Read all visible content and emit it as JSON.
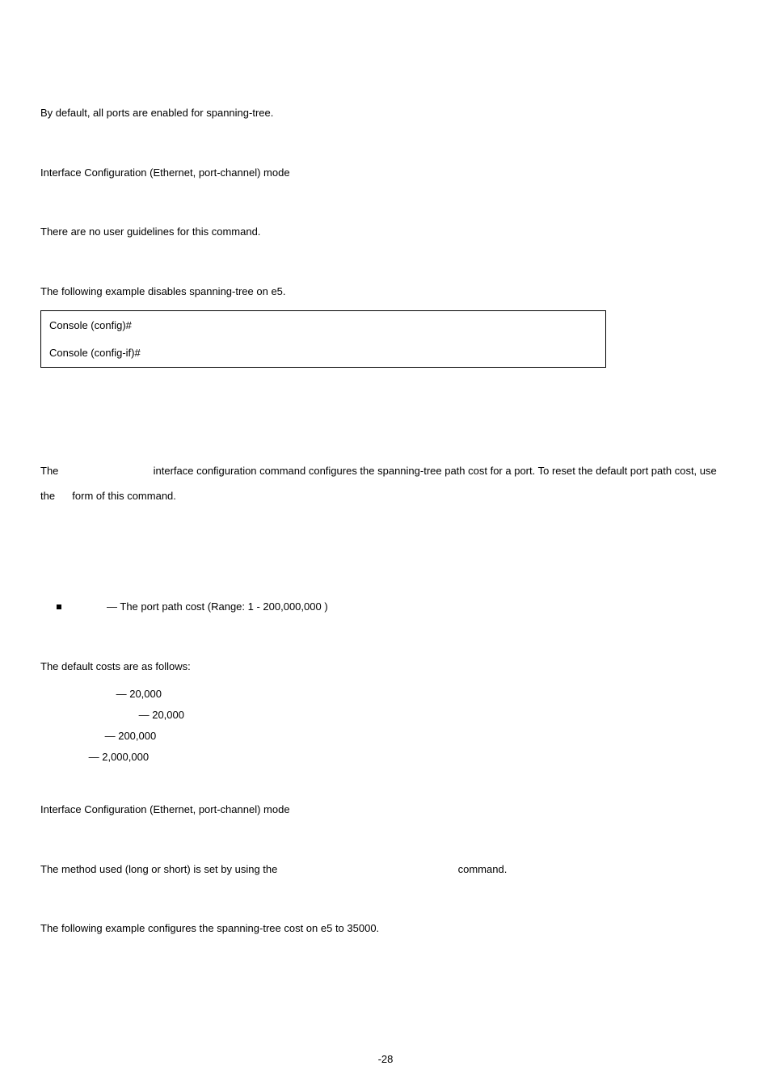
{
  "sec_default_config": {
    "text": "By default, all ports are enabled for spanning-tree."
  },
  "sec_command_mode_1": {
    "text": "Interface Configuration (Ethernet, port-channel) mode"
  },
  "sec_user_guidelines_1": {
    "text": "There are no user guidelines for this command."
  },
  "sec_example_1": {
    "intro": "The following example disables spanning-tree on e5.",
    "lines": [
      "Console (config)#",
      "Console (config-if)#"
    ]
  },
  "sec_cost_desc": {
    "pre": "The ",
    "mid": " interface configuration command configures the spanning-tree path cost for a port. To reset the default port path cost, use the ",
    "post": " form of this command."
  },
  "sec_bullet": {
    "text": " — The port path cost (Range: 1 - 200,000,000 )"
  },
  "sec_default_costs": {
    "intro": "The default costs are as follows:",
    "items": [
      {
        "pad": 90,
        "text": " — 20,000"
      },
      {
        "pad": 118,
        "text": " — 20,000"
      },
      {
        "pad": 76,
        "text": " — 200,000"
      },
      {
        "pad": 56,
        "text": " — 2,000,000"
      }
    ]
  },
  "sec_command_mode_2": {
    "text": "Interface Configuration (Ethernet, port-channel) mode"
  },
  "sec_user_guidelines_2": {
    "pre": "The method used (long or short) is set by using the ",
    "post": " command."
  },
  "sec_example_2": {
    "intro": "The following example configures the spanning-tree cost on e5 to 35000."
  },
  "footer": "-28"
}
